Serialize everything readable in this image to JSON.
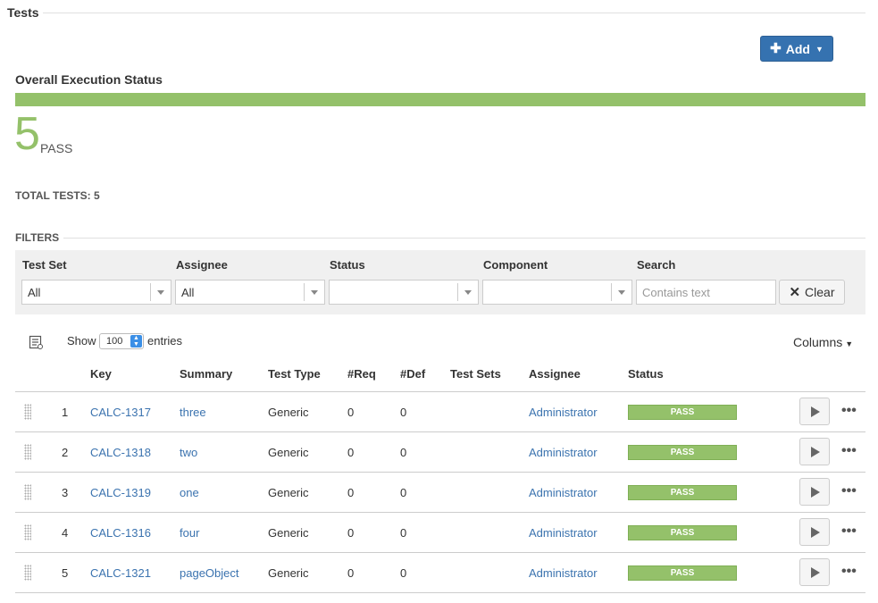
{
  "section": {
    "title": "Tests"
  },
  "toolbar": {
    "add_label": "Add",
    "add_icon": "plus-icon"
  },
  "overall": {
    "title": "Overall Execution Status",
    "pass_fraction": 1.0,
    "count": "5",
    "count_label": "PASS",
    "total_tests": "TOTAL TESTS: 5",
    "pass_color": "#94c16a"
  },
  "filters": {
    "title": "FILTERS",
    "test_set": {
      "label": "Test Set",
      "value": "All"
    },
    "assignee": {
      "label": "Assignee",
      "value": "All"
    },
    "status": {
      "label": "Status",
      "value": ""
    },
    "component": {
      "label": "Component",
      "value": ""
    },
    "search": {
      "label": "Search",
      "placeholder": "Contains text",
      "value": ""
    },
    "clear_label": "Clear"
  },
  "table_controls": {
    "show_label": "Show",
    "entries_value": "100",
    "entries_label": "entries",
    "columns_label": "Columns"
  },
  "columns": [
    "Key",
    "Summary",
    "Test Type",
    "#Req",
    "#Def",
    "Test Sets",
    "Assignee",
    "Status"
  ],
  "rows": [
    {
      "index": "1",
      "key": "CALC-1317",
      "summary": "three",
      "test_type": "Generic",
      "req": "0",
      "def": "0",
      "test_sets": "",
      "assignee": "Administrator",
      "status": "PASS"
    },
    {
      "index": "2",
      "key": "CALC-1318",
      "summary": "two",
      "test_type": "Generic",
      "req": "0",
      "def": "0",
      "test_sets": "",
      "assignee": "Administrator",
      "status": "PASS"
    },
    {
      "index": "3",
      "key": "CALC-1319",
      "summary": "one",
      "test_type": "Generic",
      "req": "0",
      "def": "0",
      "test_sets": "",
      "assignee": "Administrator",
      "status": "PASS"
    },
    {
      "index": "4",
      "key": "CALC-1316",
      "summary": "four",
      "test_type": "Generic",
      "req": "0",
      "def": "0",
      "test_sets": "",
      "assignee": "Administrator",
      "status": "PASS"
    },
    {
      "index": "5",
      "key": "CALC-1321",
      "summary": "pageObject",
      "test_type": "Generic",
      "req": "0",
      "def": "0",
      "test_sets": "",
      "assignee": "Administrator",
      "status": "PASS"
    }
  ],
  "colors": {
    "accent": "#3572b0",
    "link": "#3b73af",
    "pass": "#94c16a"
  }
}
